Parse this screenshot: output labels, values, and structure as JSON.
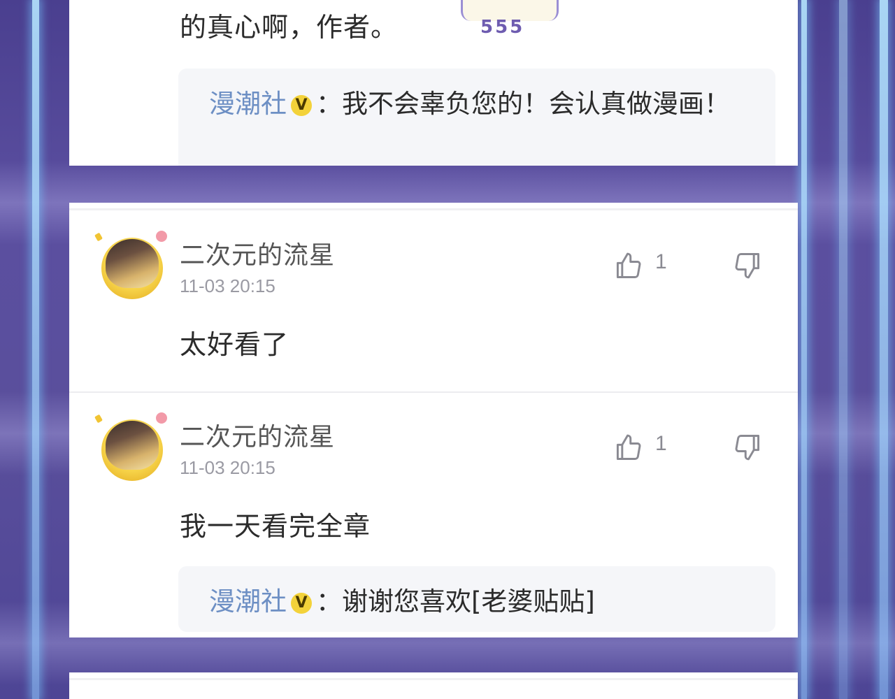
{
  "top_card": {
    "comment_tail": "的真心啊，作者。",
    "sticker_text": "555",
    "reply": {
      "author": "漫潮社",
      "badge": "V",
      "separator": "：",
      "text": "我不会辜负您的！会认真做漫画！"
    }
  },
  "comments": [
    {
      "username": "二次元的流星",
      "time": "11-03 20:15",
      "likes": "1",
      "text": "太好看了"
    },
    {
      "username": "二次元的流星",
      "time": "11-03 20:15",
      "likes": "1",
      "text": "我一天看完全章",
      "reply": {
        "author": "漫潮社",
        "badge": "V",
        "separator": "：",
        "text": "谢谢您喜欢[老婆贴贴]"
      }
    }
  ],
  "icons": {
    "like": "thumbs-up-icon",
    "dislike": "thumbs-down-icon",
    "verified": "verified-v-badge"
  },
  "colors": {
    "reply_author": "#6d8fc4",
    "badge": "#f3d23a",
    "background": "#5b4fa0"
  }
}
